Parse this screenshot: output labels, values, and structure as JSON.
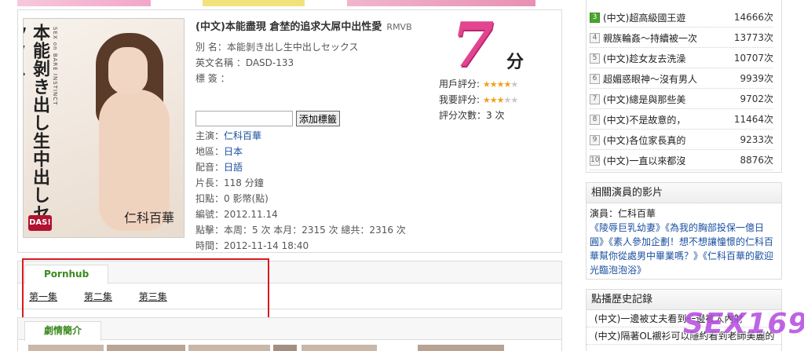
{
  "movie": {
    "title": "(中文)本能盡現 倉埜的追求大屌中出性愛",
    "format": "RMVB",
    "alias": "別 名：本能剝き出し生中出しセックス",
    "english_name": "英文名稱 ：DASD-133",
    "tags_label": "標 簽 ：",
    "add_tag_button": "添加標籤",
    "tag_input_placeholder": "",
    "cover": {
      "title": "本能剝き出し生中出しセックス",
      "subtitle": "SEX on BARE INSTINCT",
      "actress": "仁科百華",
      "logo": "DAS!"
    },
    "star_label": "主演：",
    "star": "仁科百華",
    "region_label": "地區：",
    "region": "日本",
    "dub_label": "配音：",
    "dub": "日語",
    "length": "片長：118 分鐘",
    "deduct": "扣點：0 影幣(點)",
    "date": "編號：2012.11.14",
    "clicks": "點擊：本周：5 次 本月：2315 次 總共：2316 次",
    "time": "時間：2012-11-14 18:40"
  },
  "score": {
    "value": "7",
    "unit": "分",
    "user_rating_label": "用戶評分:",
    "user_rating_stars": 4,
    "my_rating_label": "我要評分:",
    "my_rating_stars": 3,
    "votes": "評分次數：3 次",
    "colors": {
      "score": "#e2458f",
      "star_on": "#f0a020"
    }
  },
  "sources": {
    "tab": "Pornhub",
    "episodes": [
      "第一集",
      "第二集",
      "第三集"
    ]
  },
  "synopsis_tab": "劇情簡介",
  "ranking": [
    {
      "num": "3",
      "hot": true,
      "title": "(中文)超高級國王遊",
      "count": "14666次"
    },
    {
      "num": "4",
      "hot": false,
      "title": "親族輪姦～持續被一次",
      "count": "13773次"
    },
    {
      "num": "5",
      "hot": false,
      "title": "(中文)趁女友去洗澡",
      "count": "10707次"
    },
    {
      "num": "6",
      "hot": false,
      "title": "超媚惑眼神～沒有男人",
      "count": "9939次"
    },
    {
      "num": "7",
      "hot": false,
      "title": "(中文)總是與那些美",
      "count": "9702次"
    },
    {
      "num": "8",
      "hot": false,
      "title": "(中文)不是故意的，",
      "count": "11464次"
    },
    {
      "num": "9",
      "hot": false,
      "title": "(中文)各位家長真的",
      "count": "9233次"
    },
    {
      "num": "10",
      "hot": false,
      "title": "(中文)一直以來都沒",
      "count": "8876次"
    }
  ],
  "related": {
    "heading": "相關演員的影片",
    "actor_line": "演員：仁科百華",
    "links_text": "《陵辱巨乳幼妻》《為我的胸部投保一億日圓》《素人參加企劃！想不想讓憧憬的仁科百華幫你從處男中畢業嗎？》《仁科百華的歡迎光臨泡泡浴》"
  },
  "history": {
    "heading": "點播歷史記錄",
    "items": [
      "(中文)一邊被丈夫看到一邊被人內射",
      "(中文)隔著OL襯衫可以隱約看到老師美麗的"
    ]
  },
  "watermark": "SEX169"
}
